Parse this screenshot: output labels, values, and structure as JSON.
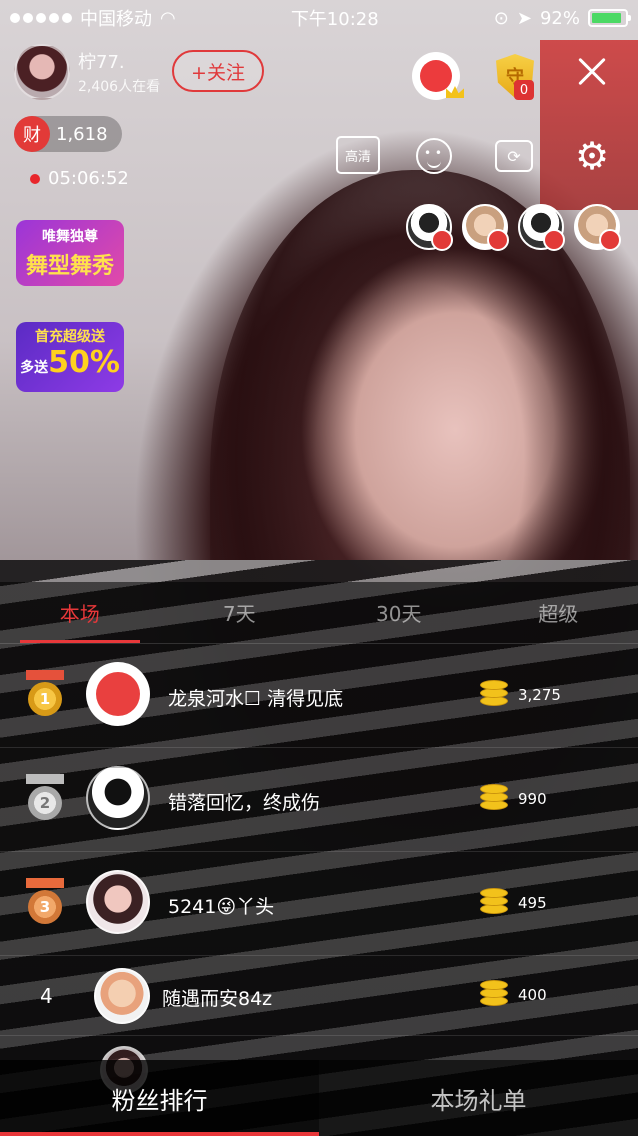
{
  "status_bar": {
    "carrier": "中国移动",
    "time": "下午10:28",
    "battery": "92%",
    "battery_level": 0.92
  },
  "host": {
    "name": "柠77.",
    "viewers": "2,406人在看",
    "follow_label": "+关注"
  },
  "guard": {
    "label": "守",
    "count": "0"
  },
  "wealth": {
    "icon_label": "财",
    "value": "1,618"
  },
  "live_time": "05:06:52",
  "tools": {
    "hd_label": "高清"
  },
  "promos": {
    "dance_top": "唯舞独尊",
    "dance_main": "舞型舞秀",
    "charge_top": "首充超级送",
    "charge_side": "多送",
    "charge_main": "50%"
  },
  "rank_tabs": [
    "本场",
    "7天",
    "30天",
    "超级"
  ],
  "ranking": [
    {
      "rank": "1",
      "name": "龙泉河水☐ 清得见底",
      "value": "3,275"
    },
    {
      "rank": "2",
      "name": "错落回忆，终成伤",
      "value": "990"
    },
    {
      "rank": "3",
      "name": "5241😜丫头",
      "value": "495"
    },
    {
      "rank": "4",
      "name": "随遇而安84z",
      "value": "400"
    }
  ],
  "bottom_tabs": [
    "粉丝排行",
    "本场礼单"
  ],
  "colors": {
    "accent": "#e8383a",
    "coin": "#f2c21b"
  }
}
